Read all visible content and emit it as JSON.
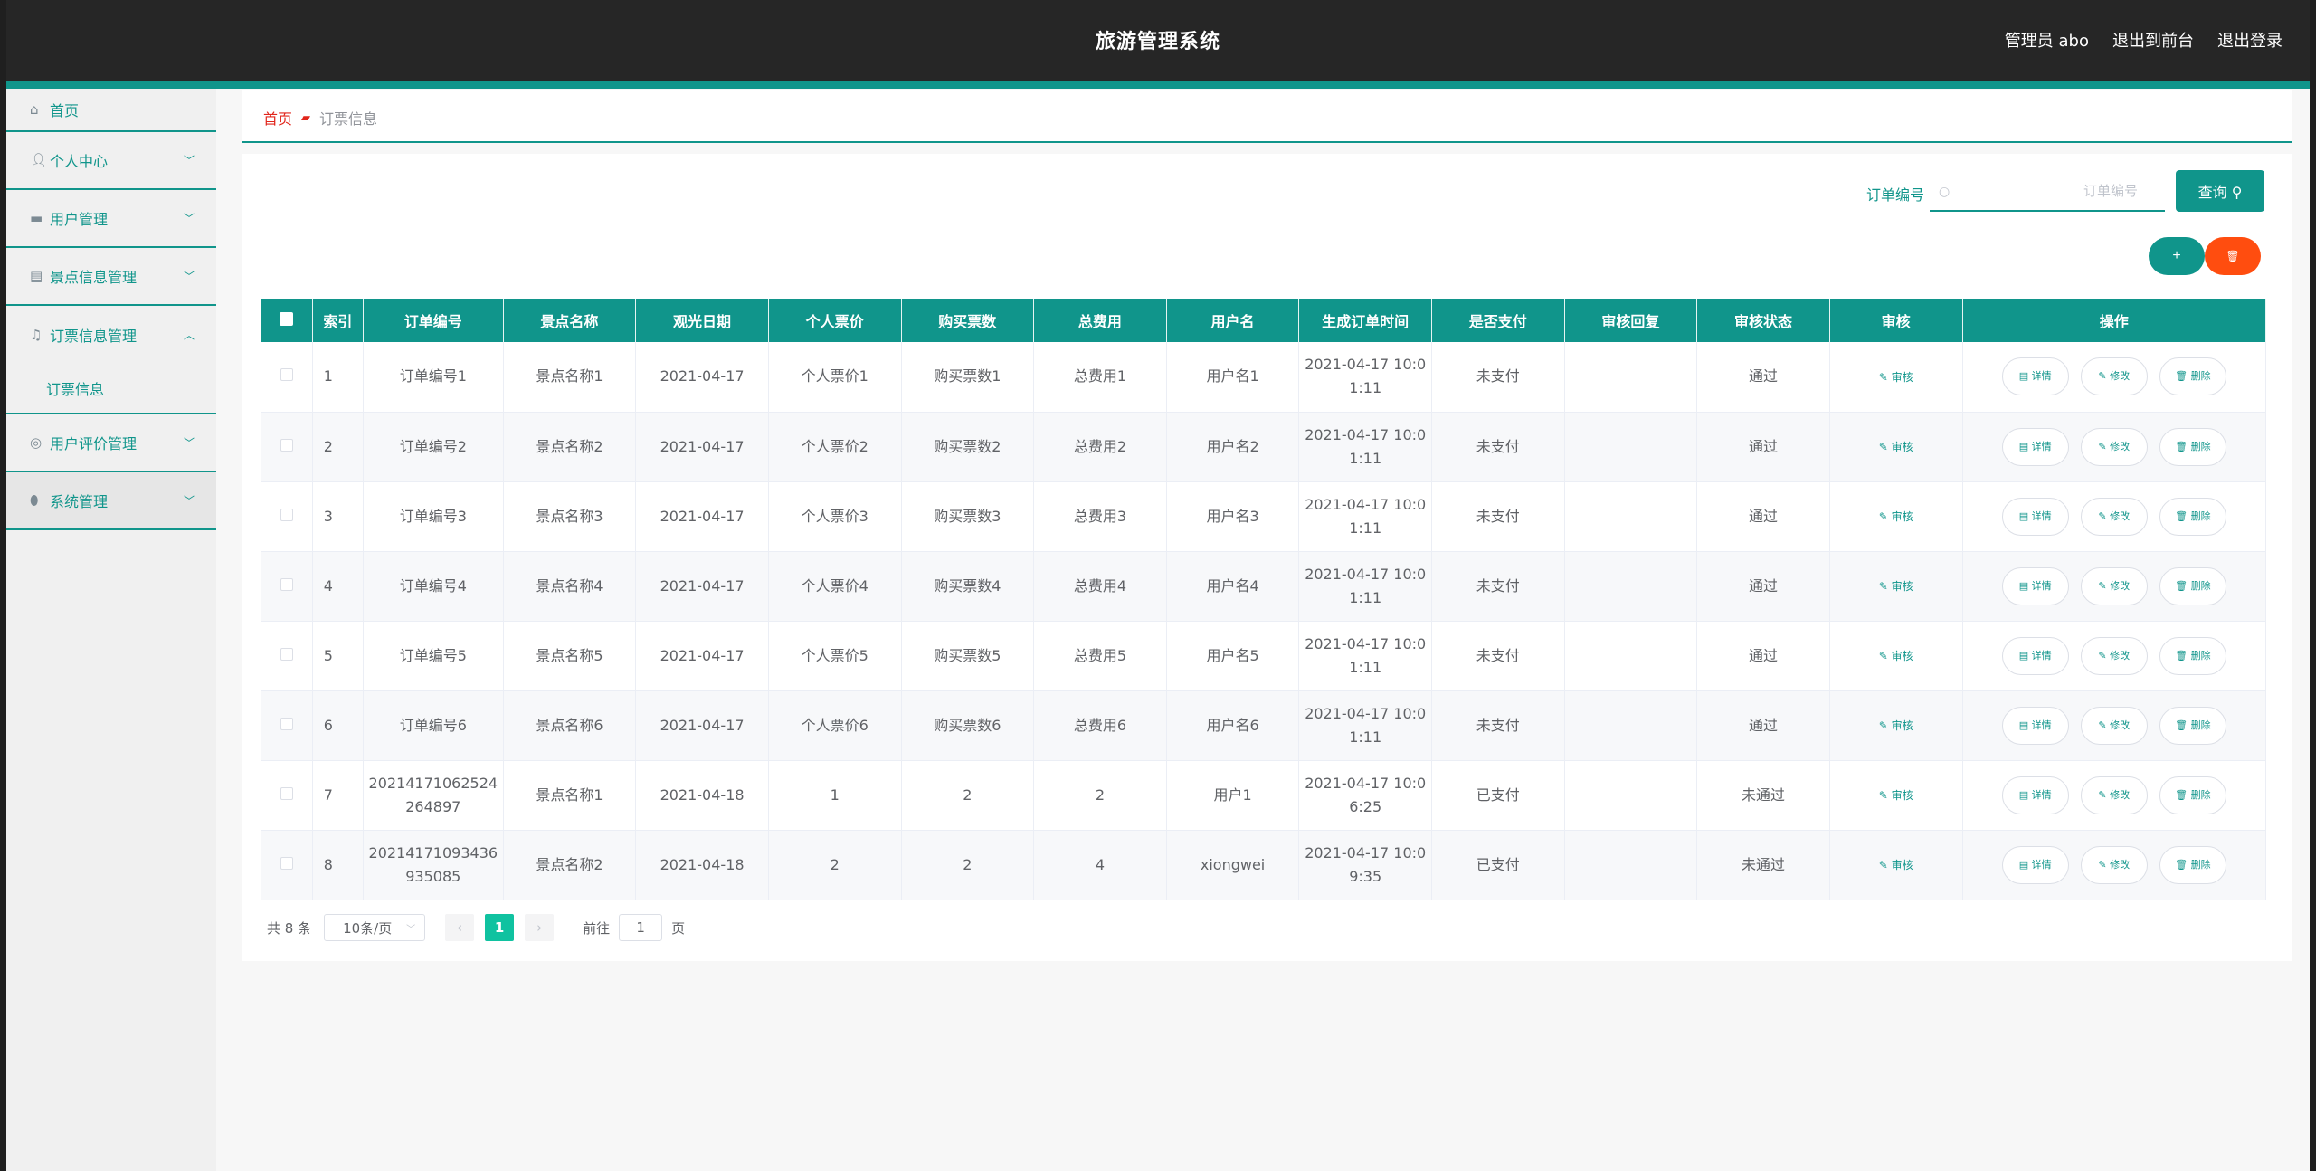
{
  "header": {
    "title": "旅游管理系统",
    "admin": "管理员 abo",
    "to_front": "退出到前台",
    "logout": "退出登录"
  },
  "sidebar": {
    "items": [
      {
        "label": "首页",
        "icon": "home-icon"
      },
      {
        "label": "个人中心",
        "icon": "user-icon"
      },
      {
        "label": "用户管理",
        "icon": "monitor-icon"
      },
      {
        "label": "景点信息管理",
        "icon": "clipboard-icon"
      },
      {
        "label": "订票信息管理",
        "icon": "bell-icon"
      },
      {
        "label": "用户评价管理",
        "icon": "comment-icon"
      },
      {
        "label": "系统管理",
        "icon": "shield-icon"
      }
    ],
    "submenu": {
      "label": "订票信息"
    }
  },
  "breadcrumb": {
    "home": "首页",
    "current": "订票信息"
  },
  "search": {
    "label": "订单编号",
    "placeholder": "订单编号",
    "button": "查询"
  },
  "actions": {
    "add": "+",
    "delete": "🗑"
  },
  "table": {
    "columns": [
      "索引",
      "订单编号",
      "景点名称",
      "观光日期",
      "个人票价",
      "购买票数",
      "总费用",
      "用户名",
      "生成订单时间",
      "是否支付",
      "审核回复",
      "审核状态",
      "审核",
      "操作"
    ],
    "review_label": "审核",
    "op_detail": "详情",
    "op_edit": "修改",
    "op_delete": "删除",
    "rows": [
      {
        "idx": "1",
        "order": "订单编号1",
        "spot": "景点名称1",
        "date": "2021-04-17",
        "price": "个人票价1",
        "count": "购买票数1",
        "total": "总费用1",
        "user": "用户名1",
        "time": "2021-04-17 10:01:11",
        "paid": "未支付",
        "reply": "",
        "status": "通过"
      },
      {
        "idx": "2",
        "order": "订单编号2",
        "spot": "景点名称2",
        "date": "2021-04-17",
        "price": "个人票价2",
        "count": "购买票数2",
        "total": "总费用2",
        "user": "用户名2",
        "time": "2021-04-17 10:01:11",
        "paid": "未支付",
        "reply": "",
        "status": "通过"
      },
      {
        "idx": "3",
        "order": "订单编号3",
        "spot": "景点名称3",
        "date": "2021-04-17",
        "price": "个人票价3",
        "count": "购买票数3",
        "total": "总费用3",
        "user": "用户名3",
        "time": "2021-04-17 10:01:11",
        "paid": "未支付",
        "reply": "",
        "status": "通过"
      },
      {
        "idx": "4",
        "order": "订单编号4",
        "spot": "景点名称4",
        "date": "2021-04-17",
        "price": "个人票价4",
        "count": "购买票数4",
        "total": "总费用4",
        "user": "用户名4",
        "time": "2021-04-17 10:01:11",
        "paid": "未支付",
        "reply": "",
        "status": "通过"
      },
      {
        "idx": "5",
        "order": "订单编号5",
        "spot": "景点名称5",
        "date": "2021-04-17",
        "price": "个人票价5",
        "count": "购买票数5",
        "total": "总费用5",
        "user": "用户名5",
        "time": "2021-04-17 10:01:11",
        "paid": "未支付",
        "reply": "",
        "status": "通过"
      },
      {
        "idx": "6",
        "order": "订单编号6",
        "spot": "景点名称6",
        "date": "2021-04-17",
        "price": "个人票价6",
        "count": "购买票数6",
        "total": "总费用6",
        "user": "用户名6",
        "time": "2021-04-17 10:01:11",
        "paid": "未支付",
        "reply": "",
        "status": "通过"
      },
      {
        "idx": "7",
        "order": "20214171062524264897",
        "spot": "景点名称1",
        "date": "2021-04-18",
        "price": "1",
        "count": "2",
        "total": "2",
        "user": "用户1",
        "time": "2021-04-17 10:06:25",
        "paid": "已支付",
        "reply": "",
        "status": "未通过"
      },
      {
        "idx": "8",
        "order": "20214171093436935085",
        "spot": "景点名称2",
        "date": "2021-04-18",
        "price": "2",
        "count": "2",
        "total": "4",
        "user": "xiongwei",
        "time": "2021-04-17 10:09:35",
        "paid": "已支付",
        "reply": "",
        "status": "未通过"
      }
    ]
  },
  "pagination": {
    "total": "共 8 条",
    "page_size": "10条/页",
    "current": "1",
    "goto_prefix": "前往",
    "goto_value": "1",
    "goto_suffix": "页"
  },
  "colors": {
    "accent": "#10958b",
    "danger": "#ff4d0f",
    "header_bg": "#262626"
  }
}
